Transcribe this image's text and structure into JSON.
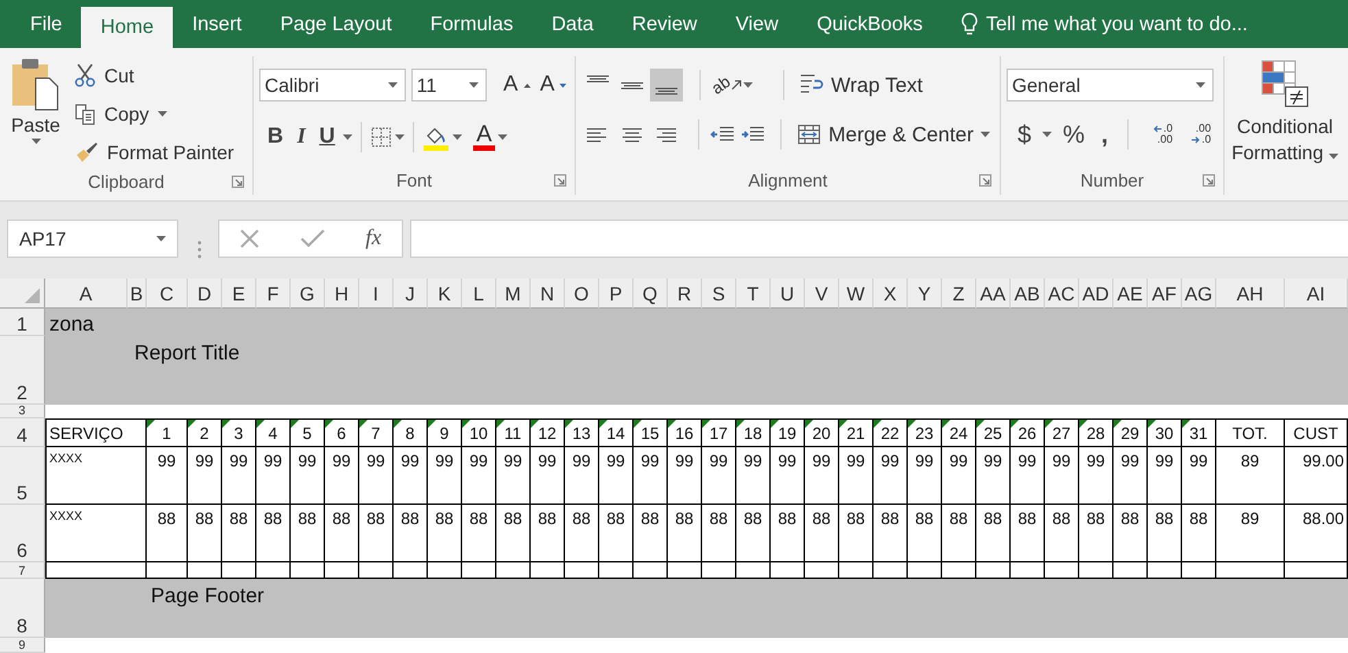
{
  "ribbon_tabs": [
    {
      "label": "File",
      "selected": false
    },
    {
      "label": "Home",
      "selected": true
    },
    {
      "label": "Insert",
      "selected": false
    },
    {
      "label": "Page Layout",
      "selected": false
    },
    {
      "label": "Formulas",
      "selected": false
    },
    {
      "label": "Data",
      "selected": false
    },
    {
      "label": "Review",
      "selected": false
    },
    {
      "label": "View",
      "selected": false
    },
    {
      "label": "QuickBooks",
      "selected": false
    }
  ],
  "tell_me": {
    "text": "Tell me what you want to do..."
  },
  "clipboard": {
    "label": "Clipboard",
    "paste": "Paste",
    "commands": [
      {
        "kind": "cut",
        "label": "Cut"
      },
      {
        "kind": "copy",
        "label": "Copy"
      },
      {
        "kind": "format_painter",
        "label": "Format Painter"
      }
    ]
  },
  "font": {
    "label": "Font",
    "family": "Calibri",
    "size": "11",
    "grow": "A",
    "shrink": "A",
    "bold": "B",
    "italic": "I",
    "underline": "U",
    "color_button": "A"
  },
  "alignment": {
    "label": "Alignment",
    "vertical": [
      {
        "kind": "top",
        "selected": false
      },
      {
        "kind": "middle",
        "selected": false
      },
      {
        "kind": "bottom",
        "selected": true
      }
    ],
    "orientation": "ab",
    "wrap_text": "Wrap Text",
    "merge_center": "Merge & Center"
  },
  "number": {
    "label": "Number",
    "format": "General",
    "currency": "$",
    "percent": "%",
    "comma": ",",
    "decimals": [
      {
        "kind": "increase",
        "top": ".0",
        "bottom": ".00"
      },
      {
        "kind": "decrease",
        "top": ".00",
        "bottom": ".0"
      }
    ]
  },
  "styles": {
    "conditional_formatting": "Conditional Formatting"
  },
  "formula_bar": {
    "name_box": "AP17",
    "function_label": "fx"
  },
  "sheet": {
    "columns": [
      "A",
      "B",
      "C",
      "D",
      "E",
      "F",
      "G",
      "H",
      "I",
      "J",
      "K",
      "L",
      "M",
      "N",
      "O",
      "P",
      "Q",
      "R",
      "S",
      "T",
      "U",
      "V",
      "W",
      "X",
      "Y",
      "Z",
      "AA",
      "AB",
      "AC",
      "AD",
      "AE",
      "AF",
      "AG",
      "AH",
      "AI"
    ],
    "row_numbers": [
      "1",
      "2",
      "3",
      "4",
      "5",
      "6",
      "7",
      "8",
      "9"
    ],
    "report_header": "zona",
    "report_title": "Report Title",
    "table": {
      "header": [
        {
          "text": "SERVIÇO",
          "flagged": false
        },
        {
          "text": "1",
          "flagged": true
        },
        {
          "text": "2",
          "flagged": true
        },
        {
          "text": "3",
          "flagged": true
        },
        {
          "text": "4",
          "flagged": true
        },
        {
          "text": "5",
          "flagged": true
        },
        {
          "text": "6",
          "flagged": true
        },
        {
          "text": "7",
          "flagged": true
        },
        {
          "text": "8",
          "flagged": true
        },
        {
          "text": "9",
          "flagged": true
        },
        {
          "text": "10",
          "flagged": true
        },
        {
          "text": "11",
          "flagged": true
        },
        {
          "text": "12",
          "flagged": true
        },
        {
          "text": "13",
          "flagged": true
        },
        {
          "text": "14",
          "flagged": true
        },
        {
          "text": "15",
          "flagged": true
        },
        {
          "text": "16",
          "flagged": true
        },
        {
          "text": "17",
          "flagged": true
        },
        {
          "text": "18",
          "flagged": true
        },
        {
          "text": "19",
          "flagged": true
        },
        {
          "text": "20",
          "flagged": true
        },
        {
          "text": "21",
          "flagged": true
        },
        {
          "text": "22",
          "flagged": true
        },
        {
          "text": "23",
          "flagged": true
        },
        {
          "text": "24",
          "flagged": true
        },
        {
          "text": "25",
          "flagged": true
        },
        {
          "text": "26",
          "flagged": true
        },
        {
          "text": "27",
          "flagged": true
        },
        {
          "text": "28",
          "flagged": true
        },
        {
          "text": "29",
          "flagged": true
        },
        {
          "text": "30",
          "flagged": true
        },
        {
          "text": "31",
          "flagged": true
        },
        {
          "text": "TOT.",
          "flagged": false
        },
        {
          "text": "CUST",
          "flagged": false
        }
      ],
      "rows": [
        {
          "name": "XXXX",
          "days": [
            "99",
            "99",
            "99",
            "99",
            "99",
            "99",
            "99",
            "99",
            "99",
            "99",
            "99",
            "99",
            "99",
            "99",
            "99",
            "99",
            "99",
            "99",
            "99",
            "99",
            "99",
            "99",
            "99",
            "99",
            "99",
            "99",
            "99",
            "99",
            "99",
            "99",
            "99"
          ],
          "total": "89",
          "cost": "99.00"
        },
        {
          "name": "XXXX",
          "days": [
            "88",
            "88",
            "88",
            "88",
            "88",
            "88",
            "88",
            "88",
            "88",
            "88",
            "88",
            "88",
            "88",
            "88",
            "88",
            "88",
            "88",
            "88",
            "88",
            "88",
            "88",
            "88",
            "88",
            "88",
            "88",
            "88",
            "88",
            "88",
            "88",
            "88",
            "88"
          ],
          "total": "89",
          "cost": "88.00"
        }
      ]
    },
    "page_footer": "Page Footer"
  }
}
